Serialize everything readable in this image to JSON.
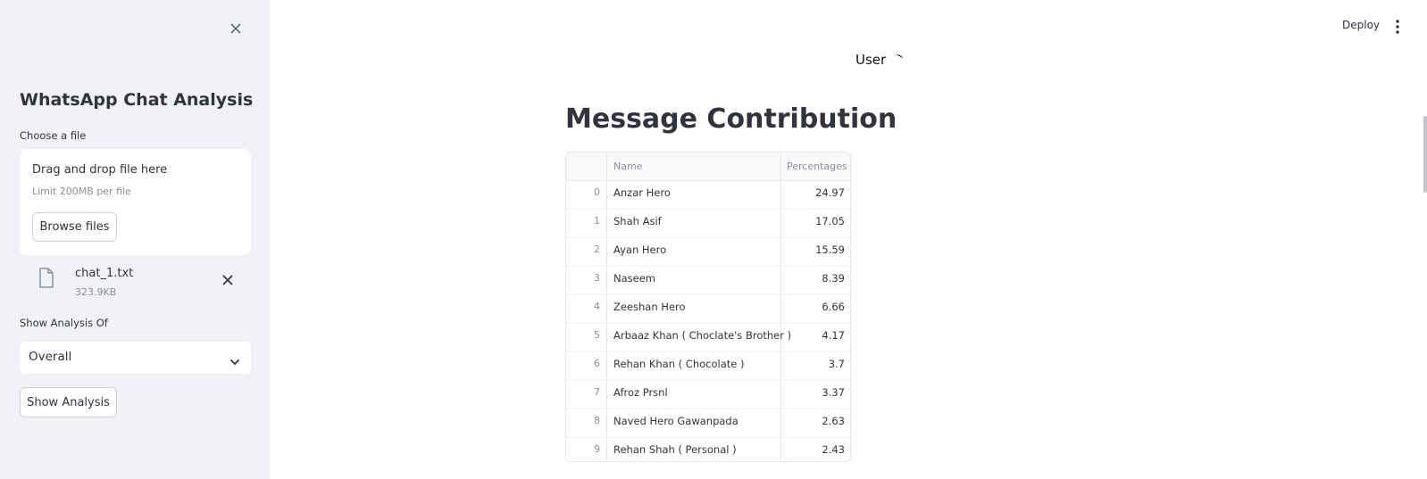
{
  "sidebar": {
    "title": "WhatsApp Chat Analysis",
    "choose_label": "Choose a file",
    "dropzone": {
      "title": "Drag and drop file here",
      "limit": "Limit 200MB per file",
      "browse_label": "Browse files"
    },
    "file": {
      "name": "chat_1.txt",
      "size": "323.9KB"
    },
    "analysis_label": "Show Analysis Of",
    "analysis_value": "Overall",
    "show_button": "Show Analysis"
  },
  "topbar": {
    "deploy_label": "Deploy"
  },
  "main": {
    "user_label": "User",
    "title": "Message Contribution",
    "table": {
      "columns": [
        "Name",
        "Percentages"
      ],
      "rows": [
        {
          "idx": "0",
          "name": "Anzar Hero",
          "pct": "24.97"
        },
        {
          "idx": "1",
          "name": "Shah Asif",
          "pct": "17.05"
        },
        {
          "idx": "2",
          "name": "Ayan Hero",
          "pct": "15.59"
        },
        {
          "idx": "3",
          "name": "Naseem",
          "pct": "8.39"
        },
        {
          "idx": "4",
          "name": "Zeeshan Hero",
          "pct": "6.66"
        },
        {
          "idx": "5",
          "name": "Arbaaz Khan ( Choclate's Brother )",
          "pct": "4.17"
        },
        {
          "idx": "6",
          "name": "Rehan Khan ( Chocolate )",
          "pct": "3.7"
        },
        {
          "idx": "7",
          "name": "Afroz Prsnl",
          "pct": "3.37"
        },
        {
          "idx": "8",
          "name": "Naved Hero Gawanpada",
          "pct": "2.63"
        },
        {
          "idx": "9",
          "name": "Rehan Shah ( Personal )",
          "pct": "2.43"
        }
      ]
    }
  }
}
